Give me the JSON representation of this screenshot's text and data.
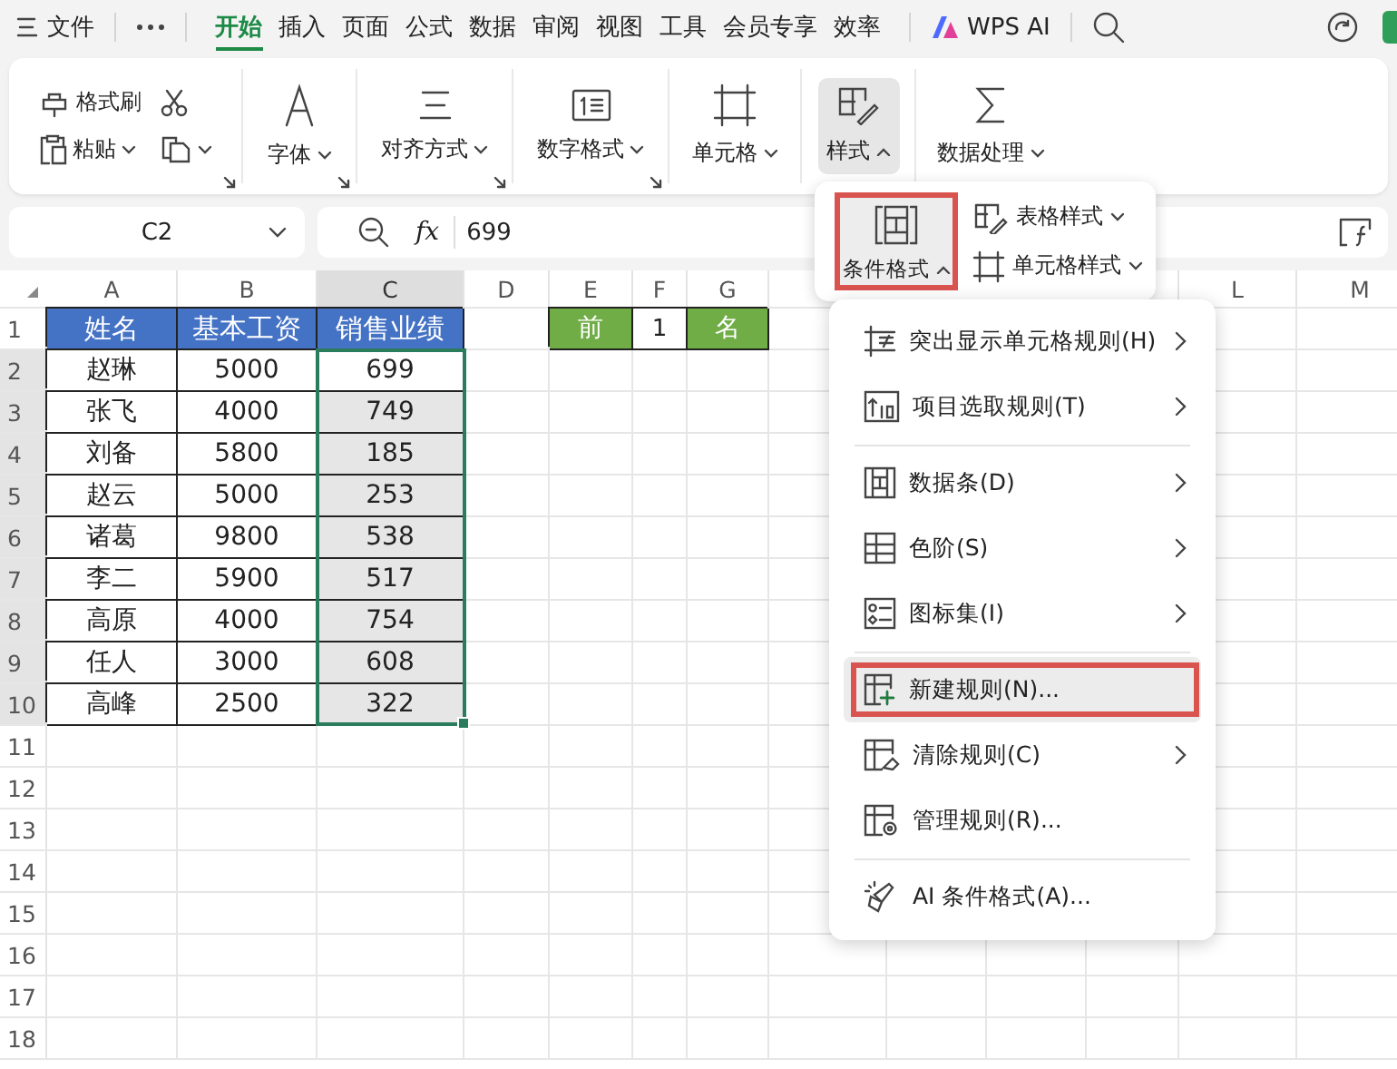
{
  "menu_bar": {
    "file": "文件",
    "tabs": [
      {
        "label": "开始",
        "selected": true
      },
      {
        "label": "插入",
        "selected": false
      },
      {
        "label": "页面",
        "selected": false
      },
      {
        "label": "公式",
        "selected": false
      },
      {
        "label": "数据",
        "selected": false
      },
      {
        "label": "审阅",
        "selected": false
      },
      {
        "label": "视图",
        "selected": false
      },
      {
        "label": "工具",
        "selected": false
      },
      {
        "label": "会员专享",
        "selected": false
      },
      {
        "label": "效率",
        "selected": false
      }
    ],
    "ai_button": "WPS AI"
  },
  "ribbon": {
    "groups": [
      {
        "kind": "clipboard",
        "launcher": true,
        "items": [
          {
            "kind": "format-painter",
            "label": "格式刷"
          },
          {
            "kind": "cut"
          },
          {
            "kind": "paste",
            "label": "粘贴"
          },
          {
            "kind": "copy"
          }
        ]
      },
      {
        "kind": "font",
        "label": "字体",
        "expanded": false,
        "launcher": true
      },
      {
        "kind": "align",
        "label": "对齐方式",
        "expanded": false,
        "launcher": true
      },
      {
        "kind": "number",
        "label": "数字格式",
        "expanded": false,
        "launcher": true
      },
      {
        "kind": "cell",
        "label": "单元格",
        "expanded": false,
        "launcher": false
      },
      {
        "kind": "styles",
        "label": "样式",
        "expanded": true,
        "launcher": false
      },
      {
        "kind": "data",
        "label": "数据处理",
        "expanded": false,
        "launcher": false
      }
    ]
  },
  "formula_bar": {
    "name_box": "C2",
    "function_label": "fx",
    "value": "699"
  },
  "sheet": {
    "columns": [
      {
        "label": "A",
        "selected": false
      },
      {
        "label": "B",
        "selected": false
      },
      {
        "label": "C",
        "selected": true
      },
      {
        "label": "D",
        "selected": false
      },
      {
        "label": "E",
        "selected": false
      },
      {
        "label": "F",
        "selected": false
      },
      {
        "label": "G",
        "selected": false
      }
    ],
    "columns_right": [
      {
        "label": "L",
        "selected": false
      },
      {
        "label": "M",
        "selected": false
      }
    ],
    "rows": [
      {
        "number": "1",
        "selected": false,
        "cells": [
          {
            "text": "姓名",
            "kind": "header",
            "selected": false
          },
          {
            "text": "基本工资",
            "kind": "header",
            "selected": false
          },
          {
            "text": "销售业绩",
            "kind": "header",
            "selected": false
          }
        ],
        "side_cells": [
          {
            "text": "前",
            "kind": "tag"
          },
          {
            "text": "1",
            "kind": "input"
          },
          {
            "text": "名",
            "kind": "tag"
          }
        ]
      },
      {
        "number": "2",
        "selected": true,
        "cells": [
          {
            "text": "赵琳",
            "kind": "data",
            "selected": false
          },
          {
            "text": "5000",
            "kind": "data",
            "selected": false
          },
          {
            "text": "699",
            "kind": "data",
            "selected": true
          }
        ]
      },
      {
        "number": "3",
        "selected": true,
        "cells": [
          {
            "text": "张飞",
            "kind": "data",
            "selected": false
          },
          {
            "text": "4000",
            "kind": "data",
            "selected": false
          },
          {
            "text": "749",
            "kind": "data",
            "selected": true
          }
        ]
      },
      {
        "number": "4",
        "selected": true,
        "cells": [
          {
            "text": "刘备",
            "kind": "data",
            "selected": false
          },
          {
            "text": "5800",
            "kind": "data",
            "selected": false
          },
          {
            "text": "185",
            "kind": "data",
            "selected": true
          }
        ]
      },
      {
        "number": "5",
        "selected": true,
        "cells": [
          {
            "text": "赵云",
            "kind": "data",
            "selected": false
          },
          {
            "text": "5000",
            "kind": "data",
            "selected": false
          },
          {
            "text": "253",
            "kind": "data",
            "selected": true
          }
        ]
      },
      {
        "number": "6",
        "selected": true,
        "cells": [
          {
            "text": "诸葛",
            "kind": "data",
            "selected": false
          },
          {
            "text": "9800",
            "kind": "data",
            "selected": false
          },
          {
            "text": "538",
            "kind": "data",
            "selected": true
          }
        ]
      },
      {
        "number": "7",
        "selected": true,
        "cells": [
          {
            "text": "李二",
            "kind": "data",
            "selected": false
          },
          {
            "text": "5900",
            "kind": "data",
            "selected": false
          },
          {
            "text": "517",
            "kind": "data",
            "selected": true
          }
        ]
      },
      {
        "number": "8",
        "selected": true,
        "cells": [
          {
            "text": "高原",
            "kind": "data",
            "selected": false
          },
          {
            "text": "4000",
            "kind": "data",
            "selected": false
          },
          {
            "text": "754",
            "kind": "data",
            "selected": true
          }
        ]
      },
      {
        "number": "9",
        "selected": true,
        "cells": [
          {
            "text": "任人",
            "kind": "data",
            "selected": false
          },
          {
            "text": "3000",
            "kind": "data",
            "selected": false
          },
          {
            "text": "608",
            "kind": "data",
            "selected": true
          }
        ]
      },
      {
        "number": "10",
        "selected": true,
        "cells": [
          {
            "text": "高峰",
            "kind": "data",
            "selected": false
          },
          {
            "text": "2500",
            "kind": "data",
            "selected": false
          },
          {
            "text": "322",
            "kind": "data",
            "selected": true
          }
        ]
      },
      {
        "number": "11",
        "selected": false
      },
      {
        "number": "12",
        "selected": false
      },
      {
        "number": "13",
        "selected": false
      },
      {
        "number": "14",
        "selected": false
      },
      {
        "number": "15",
        "selected": false
      },
      {
        "number": "16",
        "selected": false
      },
      {
        "number": "17",
        "selected": false
      },
      {
        "number": "18",
        "selected": false
      }
    ]
  },
  "style_popup": {
    "items": [
      {
        "kind": "conditional",
        "label": "条件格式",
        "expanded": true,
        "marked": true
      },
      {
        "kind": "table-style",
        "label": "表格样式",
        "expanded": false
      },
      {
        "kind": "cell-style",
        "label": "单元格样式",
        "expanded": false
      }
    ]
  },
  "conditional_menu": {
    "sections": [
      [
        {
          "kind": "highlight",
          "label": "突出显示单元格规则(H)",
          "submenu": true,
          "hovered": false,
          "marked": false
        },
        {
          "kind": "top",
          "label": "项目选取规则(T)",
          "submenu": true,
          "hovered": false,
          "marked": false
        }
      ],
      [
        {
          "kind": "databar",
          "label": "数据条(D)",
          "submenu": true,
          "hovered": false,
          "marked": false
        },
        {
          "kind": "scale",
          "label": "色阶(S)",
          "submenu": true,
          "hovered": false,
          "marked": false
        },
        {
          "kind": "iconset",
          "label": "图标集(I)",
          "submenu": true,
          "hovered": false,
          "marked": false
        }
      ],
      [
        {
          "kind": "new",
          "label": "新建规则(N)...",
          "submenu": false,
          "hovered": true,
          "marked": true
        },
        {
          "kind": "clear",
          "label": "清除规则(C)",
          "submenu": true,
          "hovered": false,
          "marked": false
        },
        {
          "kind": "manage",
          "label": "管理规则(R)...",
          "submenu": false,
          "hovered": false,
          "marked": false
        }
      ],
      [
        {
          "kind": "ai",
          "label": "AI 条件格式(A)...",
          "submenu": false,
          "hovered": false,
          "marked": false
        }
      ]
    ]
  }
}
